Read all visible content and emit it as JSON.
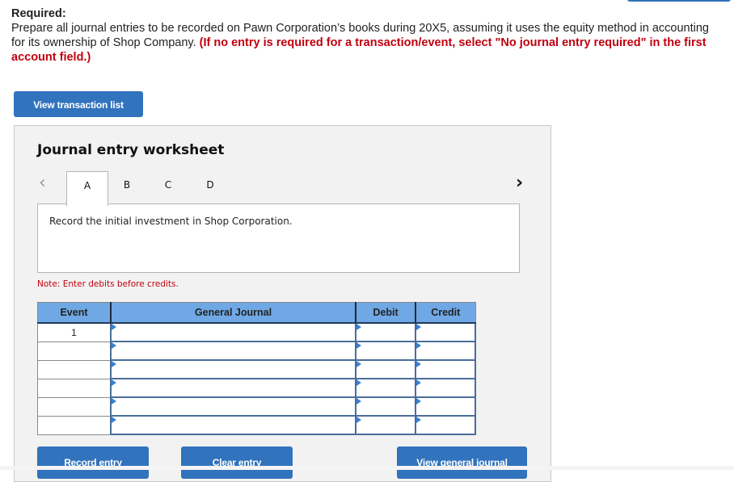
{
  "instructions": {
    "heading": "Required:",
    "body": "Prepare all journal entries to be recorded on Pawn Corporation’s books during 20X5, assuming it uses the equity method in accounting for its ownership of Shop Company. ",
    "highlight": "(If no entry is required for a transaction/event, select \"No journal entry required\" in the first account field.)"
  },
  "buttons": {
    "view_transaction_list": "View transaction list",
    "record_entry": "Record entry",
    "clear_entry": "Clear entry",
    "view_general_journal": "View general journal"
  },
  "worksheet": {
    "title": "Journal entry worksheet",
    "nav_prev_icon": "chevron-left",
    "nav_next_icon": "chevron-right",
    "tabs": [
      {
        "label": "A",
        "active": true
      },
      {
        "label": "B",
        "active": false
      },
      {
        "label": "C",
        "active": false
      },
      {
        "label": "D",
        "active": false
      }
    ],
    "description": "Record the initial investment in Shop Corporation.",
    "note": "Note: Enter debits before credits."
  },
  "table": {
    "headers": [
      "Event",
      "General Journal",
      "Debit",
      "Credit"
    ],
    "rows": [
      {
        "event": "1",
        "account": "",
        "debit": "",
        "credit": ""
      },
      {
        "event": "",
        "account": "",
        "debit": "",
        "credit": ""
      },
      {
        "event": "",
        "account": "",
        "debit": "",
        "credit": ""
      },
      {
        "event": "",
        "account": "",
        "debit": "",
        "credit": ""
      },
      {
        "event": "",
        "account": "",
        "debit": "",
        "credit": ""
      },
      {
        "event": "",
        "account": "",
        "debit": "",
        "credit": ""
      }
    ]
  },
  "colors": {
    "button_blue": "#3173bd",
    "header_blue": "#6fa8e4",
    "warning_red": "#c0000f",
    "panel_gray": "#f2f2f2"
  }
}
